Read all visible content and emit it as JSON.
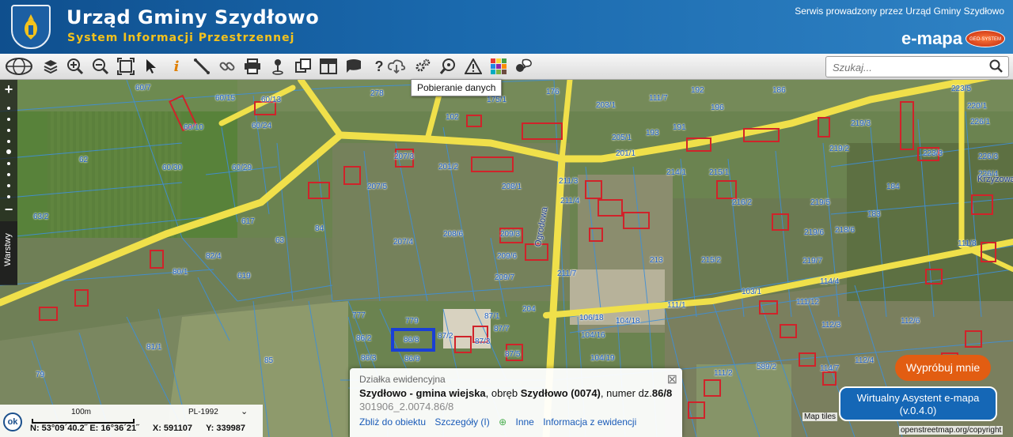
{
  "header": {
    "title": "Urząd Gminy Szydłowo",
    "subtitle": "System Informacji Przestrzennej",
    "service_note": "Serwis prowadzony przez Urząd Gminy Szydłowo",
    "brand": "e-mapa",
    "brand_badge": "GEO-SYSTEM"
  },
  "toolbar": {
    "tooltip": "Pobieranie danych",
    "search_placeholder": "Szukaj..."
  },
  "map": {
    "parcel_labels": [
      "60/7",
      "60/10",
      "60/24",
      "60/15",
      "60/13",
      "60/29",
      "60/30",
      "62",
      "63/2",
      "63",
      "84",
      "617",
      "619",
      "82/4",
      "80/1",
      "81/1",
      "85",
      "79",
      "777",
      "779",
      "86/2",
      "86/3",
      "86/9",
      "86/8",
      "87/2",
      "87/3",
      "87/5",
      "87/7",
      "87/1",
      "204",
      "111/1",
      "103/1",
      "106/18",
      "104/16",
      "104/19",
      "104/18",
      "278",
      "207/3",
      "207/5",
      "207/4",
      "208/6",
      "208/1",
      "209/3",
      "209/6",
      "209/7",
      "211/7",
      "211/3",
      "211/4",
      "213",
      "214/1",
      "215/1",
      "216/2",
      "215/2",
      "219/5",
      "219/6",
      "219/7",
      "218/6",
      "219/2",
      "219/3",
      "220/1",
      "223/5",
      "223/3",
      "226/1",
      "226/3",
      "226/4",
      "111/8",
      "111/2",
      "589/2",
      "111/12",
      "112/3",
      "114/7",
      "112/4",
      "112/6",
      "114/4",
      "111/7",
      "193",
      "191",
      "192",
      "186",
      "196",
      "201/1",
      "203/1",
      "201/2",
      "205/1",
      "102",
      "175/1",
      "176",
      "183",
      "184",
      "585",
      "539/4"
    ],
    "street_label": "Ogrodowa",
    "street_label_2": "Krzyżowa"
  },
  "controls": {
    "layers_label": "Warstwy",
    "zoom_in": "+",
    "zoom_out": "−"
  },
  "popup": {
    "title": "Działka ewidencyjna",
    "gmina": "Szydłowo - gmina wiejska",
    "obreb_prefix": ", obręb ",
    "obreb": "Szydłowo (0074)",
    "numer_prefix": ", numer dz.",
    "numer": "86/8",
    "identifier": "301906_2.0074.86/8",
    "links": {
      "zoom": "Zbliż do obiektu",
      "details": "Szczegóły (I)",
      "other": "Inne",
      "info": "Informacja z ewidencji"
    }
  },
  "coords": {
    "ok": "ok",
    "scale": "100m",
    "projection": "PL-1992",
    "lat_lon": "N: 53°09´40.2˝  E: 16°36´21˝",
    "x": "X:  591107",
    "y": "Y:  339987"
  },
  "buttons": {
    "try": "Wypróbuj mnie",
    "assistant_line1": "Wirtualny Asystent e-mapa",
    "assistant_line2": "(v.0.4.0)"
  },
  "attribution": {
    "line1": "Map tiles",
    "line2": "openstreetmap.org/copyright"
  }
}
